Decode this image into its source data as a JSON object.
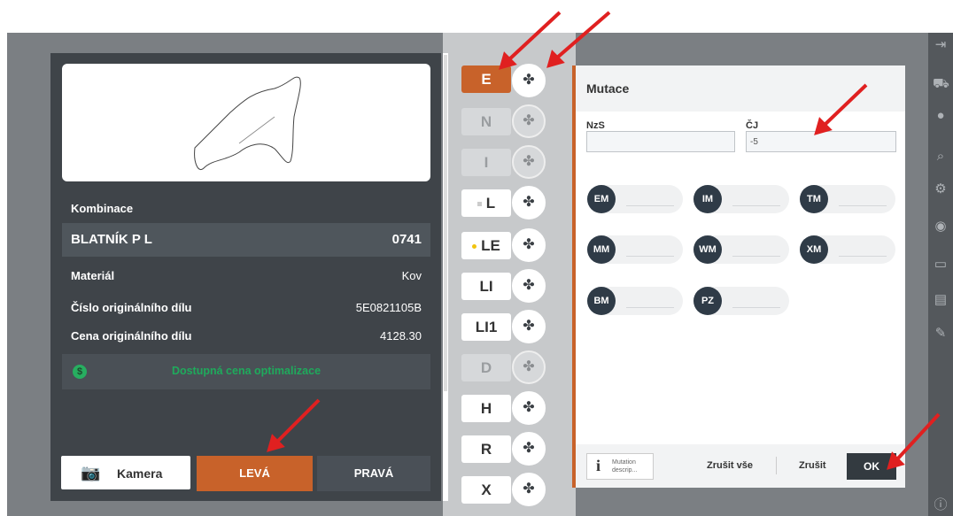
{
  "left_panel": {
    "section_label": "Kombinace",
    "part_name": "BLATNÍK P L",
    "part_code": "0741",
    "details": [
      {
        "label": "Materiál",
        "value": "Kov"
      },
      {
        "label": "Číslo originálního dílu",
        "value": "5E0821105B"
      },
      {
        "label": "Cena originálního dílu",
        "value": "4128.30"
      }
    ],
    "optimization_text": "Dostupná cena optimalizace",
    "buttons": {
      "camera": "Kamera",
      "left": "LEVÁ",
      "right": "PRAVÁ"
    }
  },
  "tabs": [
    {
      "label": "E",
      "state": "active"
    },
    {
      "label": "N",
      "state": "disabled"
    },
    {
      "label": "I",
      "state": "disabled"
    },
    {
      "label": "L",
      "state": "normal",
      "marker": "square"
    },
    {
      "label": "LE",
      "state": "normal",
      "marker": "dot-yellow"
    },
    {
      "label": "LI",
      "state": "normal"
    },
    {
      "label": "LI1",
      "state": "normal"
    },
    {
      "label": "D",
      "state": "disabled"
    },
    {
      "label": "H",
      "state": "normal"
    },
    {
      "label": "R",
      "state": "normal"
    },
    {
      "label": "X",
      "state": "normal"
    }
  ],
  "mutation_icon": "mutation-icon",
  "dialog": {
    "title": "Mutace",
    "nzs_label": "NzS",
    "nzs_value": "",
    "cj_label": "ČJ",
    "cj_value": "-5",
    "codes": [
      "EM",
      "IM",
      "TM",
      "MM",
      "WM",
      "XM",
      "BM",
      "PZ"
    ],
    "info_button": "Mutation descrip...",
    "cancel_all": "Zrušit vše",
    "cancel": "Zrušit",
    "ok": "OK"
  },
  "colors": {
    "accent": "#c8622a",
    "dark": "#3f4449",
    "optimization": "#1faa5c"
  }
}
